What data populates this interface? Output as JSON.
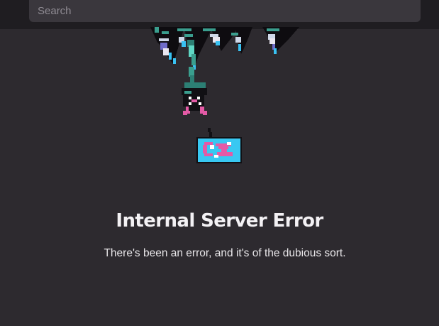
{
  "search": {
    "placeholder": "Search",
    "value": ""
  },
  "error": {
    "title": "Internal Server Error",
    "message": "There's been an error, and it's of the dubious sort."
  },
  "colors": {
    "background": "#2d2a2f",
    "topbar": "#1f1d21",
    "search_field": "#3a373d",
    "accent_cyan": "#3cc8f0",
    "accent_pink": "#e45aa6",
    "teal": "#3a9e8e"
  },
  "illustration": {
    "icon": "pixel-bat-hanging-from-cave-icon"
  }
}
